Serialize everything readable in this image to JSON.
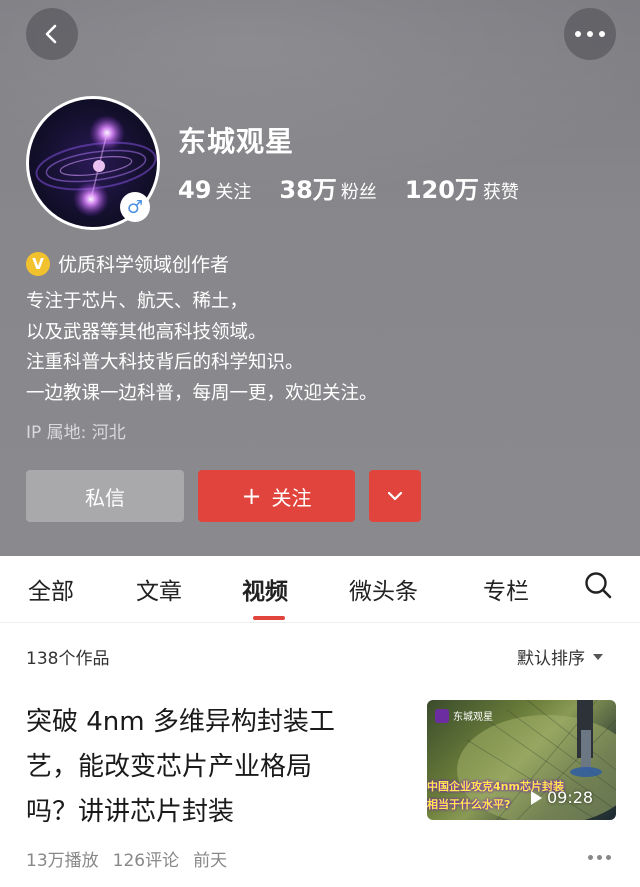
{
  "profile": {
    "name": "东城观星",
    "gender_icon": "male-icon",
    "stats": [
      {
        "num": "49",
        "label": "关注"
      },
      {
        "num": "38万",
        "label": "粉丝"
      },
      {
        "num": "120万",
        "label": "获赞"
      }
    ],
    "verification_badge": "V",
    "verification": "优质科学领域创作者",
    "bio_lines": [
      "专注于芯片、航天、稀土，",
      "以及武器等其他高科技领域。",
      "注重科普大科技背后的科学知识。",
      "一边教课一边科普，每周一更，欢迎关注。"
    ],
    "ip": "IP 属地: 河北"
  },
  "actions": {
    "message": "私信",
    "follow_plus": "+",
    "follow": "关注"
  },
  "tabs": [
    "全部",
    "文章",
    "视频",
    "微头条",
    "专栏"
  ],
  "active_tab": "视频",
  "list": {
    "count": "138个作品",
    "sort": "默认排序"
  },
  "video": {
    "title_lines": [
      "突破 4nm 多维异构封装工",
      "艺，能改变芯片产业格局",
      "吗？讲讲芯片封装"
    ],
    "thumb_channel": "东城观星",
    "thumb_caption_1": "中国企业攻克4nm芯片封装",
    "thumb_caption_2": "相当于什么水平?",
    "duration": "09:28",
    "plays": "13万播放",
    "comments": "126评论",
    "time": "前天"
  },
  "colors": {
    "accent_red": "#e0443c",
    "header_grey": "#88888c",
    "verify_gold": "#f2c22e"
  }
}
